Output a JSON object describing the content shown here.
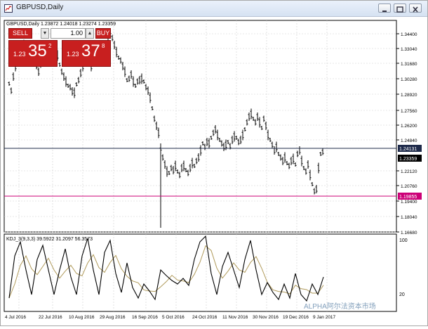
{
  "window": {
    "title": "GBPUSD,Daily"
  },
  "chart": {
    "header_ohlc": "GBPUSD,Daily  1.23872 1.24018 1.23274 1.23359",
    "price_axis": [
      "1.34400",
      "1.33040",
      "1.31680",
      "1.30280",
      "1.28920",
      "1.27560",
      "1.26200",
      "1.24840",
      "1.24131",
      "1.23359",
      "1.22120",
      "1.20760",
      "1.19855",
      "1.19400",
      "1.18040",
      "1.16680"
    ],
    "date_axis": [
      "4 Jul 2016",
      "22 Jul 2016",
      "10 Aug 2016",
      "29 Aug 2016",
      "16 Sep 2016",
      "5 Oct 2016",
      "24 Oct 2016",
      "11 Nov 2016",
      "30 Nov 2016",
      "19 Dec 2016",
      "9 Jan 2017"
    ],
    "levels": {
      "resistance_label": "1.24131",
      "current_label": "1.23359",
      "support_label": "1.19855"
    }
  },
  "trade_panel": {
    "sell_label": "SELL",
    "buy_label": "BUY",
    "lot_value": "1.00",
    "sell_prefix": "1.23",
    "sell_big": "35",
    "sell_sup": "2",
    "buy_prefix": "1.23",
    "buy_big": "37",
    "buy_sup": "8"
  },
  "indicator": {
    "header": "KDJ_3(9,3,3) 39.5922 31.2097 56.3573",
    "scale": [
      "100",
      "20"
    ]
  },
  "watermark": "ALPHA阿尔法资本市场",
  "colors": {
    "sell_red": "#c81f1f",
    "support_line": "#cc0077",
    "resistance_line": "#1e2a4a",
    "k_line": "#000000",
    "d_line": "#b09a5a"
  }
}
